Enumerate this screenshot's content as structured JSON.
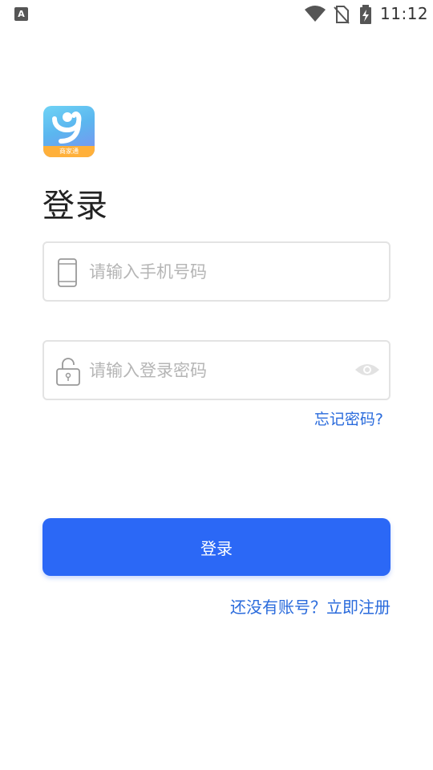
{
  "status_bar": {
    "time": "11:12",
    "left_icon": "A",
    "icons": [
      "wifi-icon",
      "no-sim-icon",
      "battery-charging-icon"
    ]
  },
  "logo": {
    "icon": "app-logo",
    "strip_text": "商家通"
  },
  "title": "登录",
  "phone_field": {
    "icon": "phone-icon",
    "placeholder": "请输入手机号码",
    "value": ""
  },
  "password_field": {
    "icon": "lock-icon",
    "placeholder": "请输入登录密码",
    "value": "",
    "toggle_icon": "eye-icon"
  },
  "forgot_password": "忘记密码?",
  "login_button": "登录",
  "register_link": "还没有账号？立即注册",
  "colors": {
    "primary": "#2b68f6",
    "link": "#2a6bdc",
    "border": "#e3e3e3",
    "placeholder": "#b5b5b5"
  }
}
